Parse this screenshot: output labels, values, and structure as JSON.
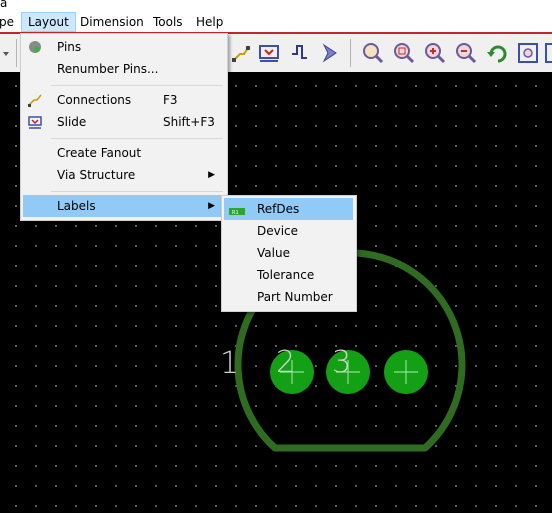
{
  "window": {
    "title_fragment": "a"
  },
  "menubar": {
    "items": [
      {
        "label": "pe"
      },
      {
        "label": "Layout"
      },
      {
        "label": "Dimension"
      },
      {
        "label": "Tools"
      },
      {
        "label": "Help"
      }
    ]
  },
  "layout_menu": {
    "items": [
      {
        "label": "Pins",
        "shortcut": "",
        "icon": "pins-icon"
      },
      {
        "label": "Renumber Pins...",
        "shortcut": ""
      },
      {
        "label": "Connections",
        "shortcut": "F3",
        "icon": "connections-icon"
      },
      {
        "label": "Slide",
        "shortcut": "Shift+F3",
        "icon": "slide-icon"
      },
      {
        "label": "Create Fanout",
        "shortcut": ""
      },
      {
        "label": "Via Structure",
        "shortcut": "",
        "submenu": true
      },
      {
        "label": "Labels",
        "shortcut": "",
        "submenu": true,
        "highlighted": true
      }
    ]
  },
  "labels_submenu": {
    "items": [
      {
        "label": "RefDes",
        "highlighted": true,
        "icon": "refdes-icon"
      },
      {
        "label": "Device"
      },
      {
        "label": "Value"
      },
      {
        "label": "Tolerance"
      },
      {
        "label": "Part Number"
      }
    ]
  },
  "canvas": {
    "pin_numbers": [
      "1",
      "2",
      "3"
    ],
    "colors": {
      "outline": "#2f6b21",
      "pad": "#14a014",
      "pad_cross": "#8ee08e",
      "pin_text": "#d0d0d0"
    }
  }
}
